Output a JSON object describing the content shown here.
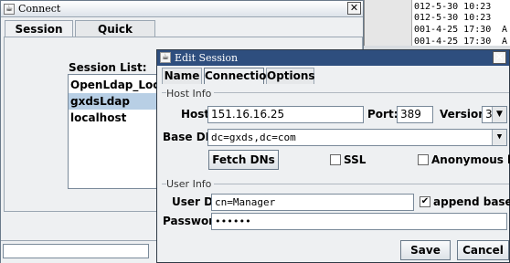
{
  "background_window": {
    "log_lines": [
      "012-5-30 10:23",
      "012-5-30 10:23",
      "001-4-25 17:30",
      "001-4-25 17:30"
    ],
    "log_suffix": "A"
  },
  "connect_window": {
    "title": "Connect",
    "close_glyph": "✕",
    "tabs": [
      {
        "label": "Session List",
        "selected": true
      },
      {
        "label": "Quick Connect",
        "selected": false
      }
    ],
    "session_list_label": "Session List:",
    "sessions": [
      "OpenLdap_Localho",
      "gxdsLdap",
      "localhost"
    ],
    "selected_session": "gxdsLdap"
  },
  "edit_session": {
    "title": "Edit Session",
    "close_glyph": "✕",
    "tabs": [
      {
        "label": "Name",
        "selected": false
      },
      {
        "label": "Connection",
        "selected": true
      },
      {
        "label": "Options",
        "selected": false
      }
    ],
    "host_info": {
      "group_label": "Host Info",
      "host_label": "Host:",
      "host_value": "151.16.16.25",
      "port_label": "Port:",
      "port_value": "389",
      "version_label": "Version:",
      "version_value": "3",
      "base_dn_label": "Base DN:",
      "base_dn_value": "dc=gxds,dc=com",
      "fetch_dns_label": "Fetch DNs",
      "ssl_label": "SSL",
      "ssl_checked": false,
      "anonymous_bind_label": "Anonymous bind",
      "anonymous_bind_checked": false
    },
    "user_info": {
      "group_label": "User Info",
      "user_dn_label": "User DN:",
      "user_dn_value": "cn=Manager",
      "append_base_dn_label": "append base DN",
      "append_base_dn_checked": true,
      "password_label": "Password:",
      "password_value": "••••••"
    },
    "buttons": {
      "save_label": "Save",
      "cancel_label": "Cancel"
    },
    "dropdown_glyph": "▼",
    "check_glyph": "✔"
  }
}
